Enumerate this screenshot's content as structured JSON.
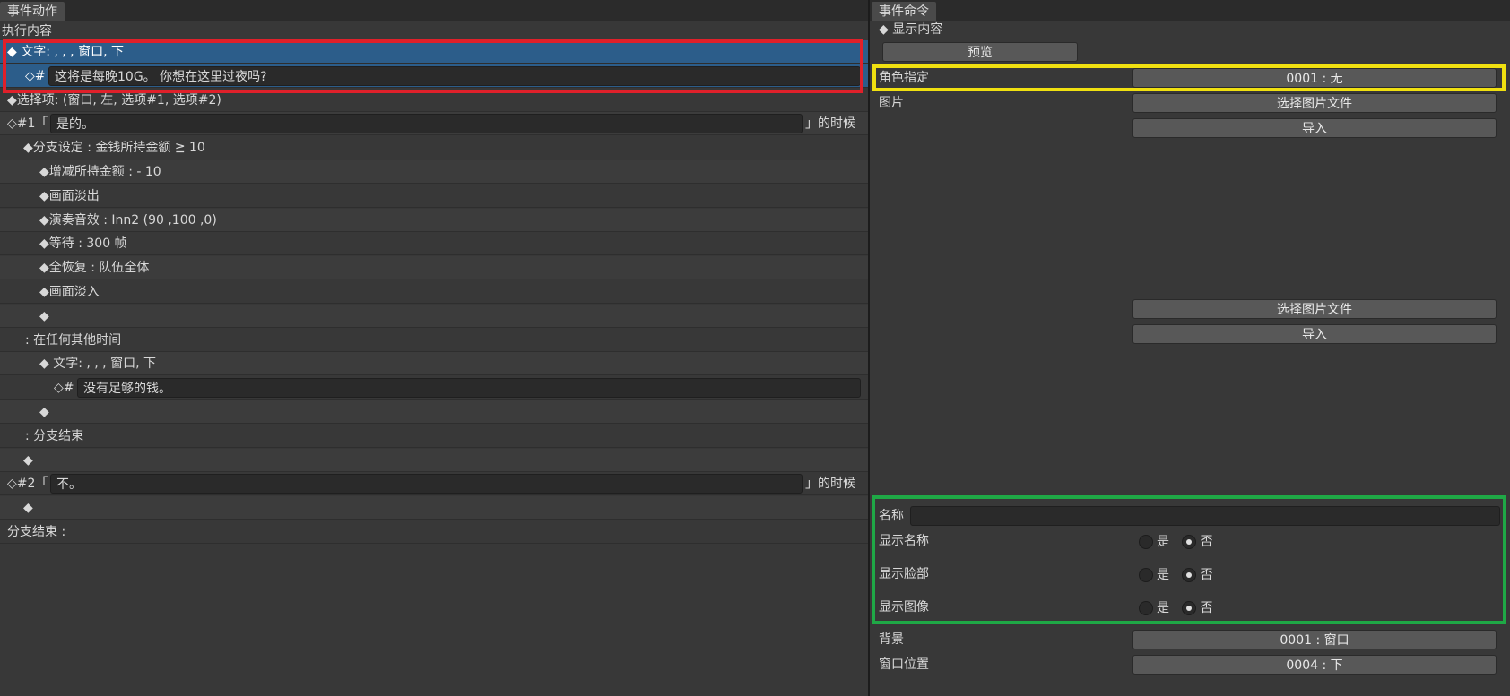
{
  "left": {
    "tab": "事件动作",
    "section": "执行内容",
    "rows": [
      {
        "indent": 8,
        "text": "◆ 文字: , , , 窗口, 下",
        "selected": true
      },
      {
        "indent": 28,
        "prefix": "◇#",
        "field": "这将是每晚10G。 你想在这里过夜吗?",
        "selected": true
      },
      {
        "indent": 8,
        "text": "◆选择项: (窗口, 左, 选项#1, 选项#2)"
      },
      {
        "indent": 8,
        "prefix": "◇#1「",
        "field": "是的。",
        "suffix": "」的时候"
      },
      {
        "indent": 26,
        "text": "◆分支设定 : 金钱所持金额 ≧ 10"
      },
      {
        "indent": 44,
        "text": "◆增减所持金额 : - 10"
      },
      {
        "indent": 44,
        "text": "◆画面淡出"
      },
      {
        "indent": 44,
        "text": "◆演奏音效 : Inn2 (90 ,100 ,0)"
      },
      {
        "indent": 44,
        "text": "◆等待 : 300 帧"
      },
      {
        "indent": 44,
        "text": "◆全恢复 : 队伍全体"
      },
      {
        "indent": 44,
        "text": "◆画面淡入"
      },
      {
        "indent": 44,
        "text": "◆"
      },
      {
        "indent": 28,
        "text": ": 在任何其他时间"
      },
      {
        "indent": 44,
        "text": "◆ 文字: , , , 窗口, 下"
      },
      {
        "indent": 60,
        "prefix": "◇#",
        "field": "没有足够的钱。"
      },
      {
        "indent": 44,
        "text": "◆"
      },
      {
        "indent": 28,
        "text": ": 分支结束"
      },
      {
        "indent": 26,
        "text": "◆"
      },
      {
        "indent": 8,
        "prefix": "◇#2「",
        "field": "不。",
        "suffix": "」的时候"
      },
      {
        "indent": 26,
        "text": "◆"
      },
      {
        "indent": 8,
        "text": "分支结束 :"
      }
    ]
  },
  "right": {
    "tab": "事件命令",
    "header": "◆ 显示内容",
    "preview_button": "预览",
    "character_label": "角色指定",
    "character_value": "0001 : 无",
    "image_label": "图片",
    "select_image_1": "选择图片文件",
    "import_1": "导入",
    "select_image_2": "选择图片文件",
    "import_2": "导入",
    "name_label": "名称",
    "name_value": "",
    "show_name_label": "显示名称",
    "show_face_label": "显示脸部",
    "show_image_label": "显示图像",
    "yes": "是",
    "no": "否",
    "background_label": "背景",
    "background_value": "0001 : 窗口",
    "window_position_label": "窗口位置",
    "window_position_value": "0004 : 下"
  },
  "colors": {
    "selection": "#2c5d8a",
    "highlight_red": "#e0202a",
    "highlight_yellow": "#f0e010",
    "highlight_green": "#1fa846"
  }
}
